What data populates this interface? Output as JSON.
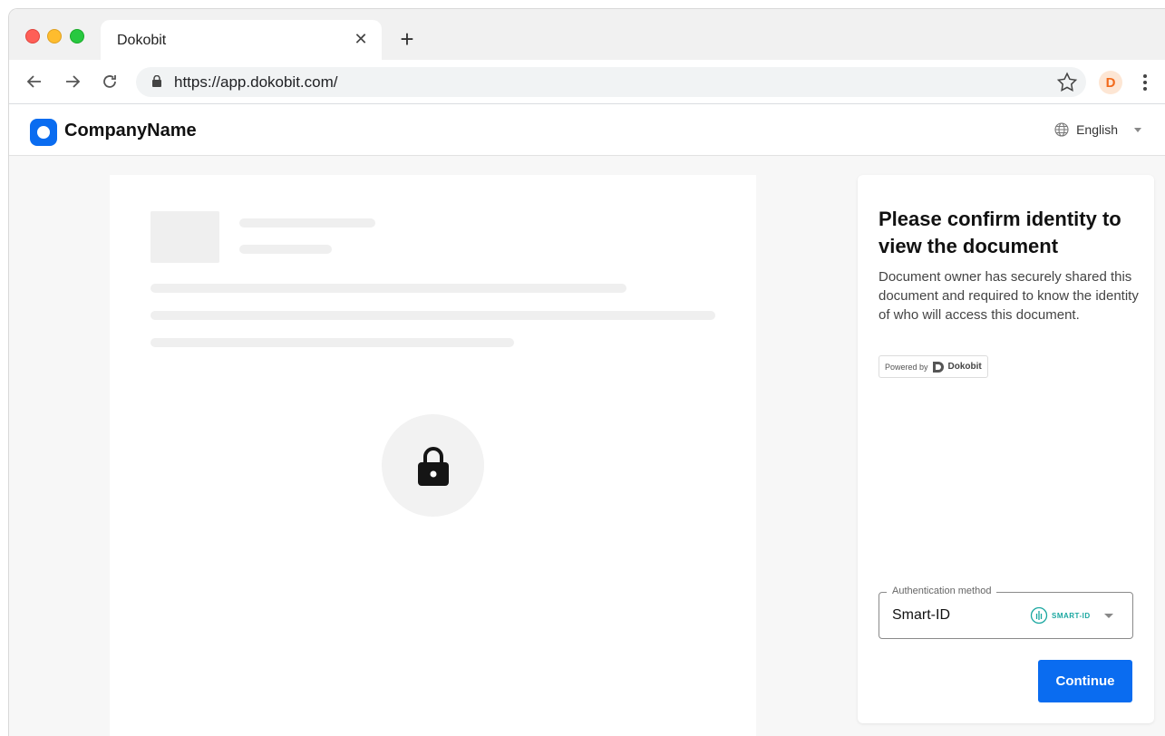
{
  "browser": {
    "tab_title": "Dokobit",
    "url": "https://app.dokobit.com/",
    "extension_letter": "D"
  },
  "header": {
    "company_name": "CompanyName",
    "language": "English"
  },
  "panel": {
    "title": "Please confirm identity to view the document",
    "description": "Document owner has securely shared this document and required to know the identity of who will access this document.",
    "powered_by_label": "Powered by",
    "powered_by_brand": "Dokobit",
    "auth_label": "Authentication method",
    "auth_value": "Smart-ID",
    "smartid_logo_text": "SMART-ID",
    "continue_label": "Continue"
  },
  "colors": {
    "primary": "#0a6cf0",
    "smartid": "#1aa7a0",
    "extension": "#f26a1b"
  }
}
